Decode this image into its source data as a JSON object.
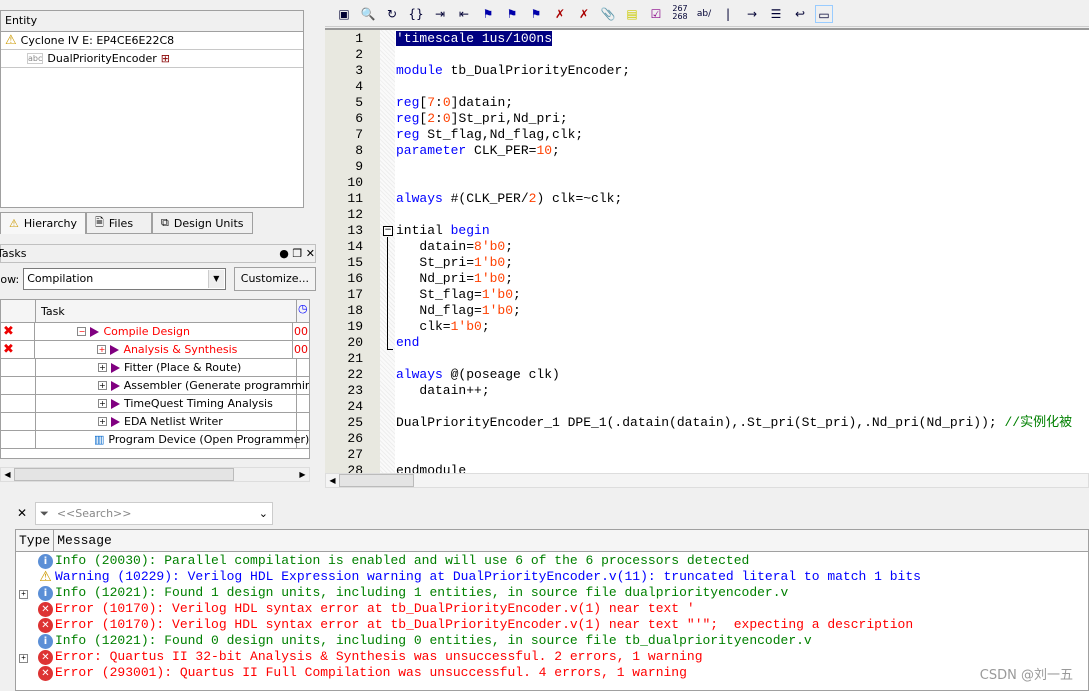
{
  "hierarchy": {
    "header": "Entity",
    "device": "Cyclone IV E: EP4CE6E22C8",
    "entity": "DualPriorityEncoder"
  },
  "tabs": [
    "Hierarchy",
    "Files",
    "Design Units"
  ],
  "tasks": {
    "title": "Tasks",
    "flow_label": "Flow:",
    "flow_value": "Compilation",
    "customize": "Customize...",
    "col_task": "Task",
    "rows": [
      {
        "label": "Compile Design",
        "status": "error",
        "time": "00",
        "color": "#ff0000",
        "indent": 0,
        "expander": "minus"
      },
      {
        "label": "Analysis & Synthesis",
        "status": "error",
        "time": "00",
        "color": "#ff0000",
        "indent": 1,
        "expander": "plus"
      },
      {
        "label": "Fitter (Place & Route)",
        "status": "",
        "time": "",
        "color": "#000000",
        "indent": 1,
        "expander": "plus"
      },
      {
        "label": "Assembler (Generate programming files)",
        "status": "",
        "time": "",
        "color": "#000000",
        "indent": 1,
        "expander": "plus"
      },
      {
        "label": "TimeQuest Timing Analysis",
        "status": "",
        "time": "",
        "color": "#000000",
        "indent": 1,
        "expander": "plus"
      },
      {
        "label": "EDA Netlist Writer",
        "status": "",
        "time": "",
        "color": "#000000",
        "indent": 1,
        "expander": "plus"
      },
      {
        "label": "Program Device (Open Programmer)",
        "status": "",
        "time": "",
        "color": "#000000",
        "indent": 0,
        "expander": "none"
      }
    ]
  },
  "toolbar": {
    "line_numbers_label": "267\n268",
    "abc_label": "ab/"
  },
  "code": [
    [
      [
        "'timescale 1us/100ns",
        "sel1"
      ]
    ],
    [],
    [
      [
        "module",
        "k"
      ],
      [
        " tb_DualPriorityEncoder;",
        ""
      ]
    ],
    [],
    [
      [
        "reg",
        "k"
      ],
      [
        "[",
        ""
      ],
      [
        "7",
        "n"
      ],
      [
        ":",
        ""
      ],
      [
        "0",
        "n"
      ],
      [
        "]datain;",
        ""
      ]
    ],
    [
      [
        "reg",
        "k"
      ],
      [
        "[",
        ""
      ],
      [
        "2",
        "n"
      ],
      [
        ":",
        ""
      ],
      [
        "0",
        "n"
      ],
      [
        "]St_pri,Nd_pri;",
        ""
      ]
    ],
    [
      [
        "reg",
        "k"
      ],
      [
        " St_flag,Nd_flag,clk;",
        ""
      ]
    ],
    [
      [
        "parameter",
        "k"
      ],
      [
        " CLK_PER=",
        ""
      ],
      [
        "10",
        "n"
      ],
      [
        ";",
        ""
      ]
    ],
    [],
    [],
    [
      [
        "always",
        "k"
      ],
      [
        " #(CLK_PER/",
        ""
      ],
      [
        "2",
        "n"
      ],
      [
        ") clk=~clk;",
        ""
      ]
    ],
    [],
    [
      [
        "intial ",
        ""
      ],
      [
        "begin",
        "k"
      ]
    ],
    [
      [
        "   datain=",
        ""
      ],
      [
        "8'b0",
        "n"
      ],
      [
        ";",
        ""
      ]
    ],
    [
      [
        "   St_pri=",
        ""
      ],
      [
        "1'b0",
        "n"
      ],
      [
        ";",
        ""
      ]
    ],
    [
      [
        "   Nd_pri=",
        ""
      ],
      [
        "1'b0",
        "n"
      ],
      [
        ";",
        ""
      ]
    ],
    [
      [
        "   St_flag=",
        ""
      ],
      [
        "1'b0",
        "n"
      ],
      [
        ";",
        ""
      ]
    ],
    [
      [
        "   Nd_flag=",
        ""
      ],
      [
        "1'b0",
        "n"
      ],
      [
        ";",
        ""
      ]
    ],
    [
      [
        "   clk=",
        ""
      ],
      [
        "1'b0",
        "n"
      ],
      [
        ";",
        ""
      ]
    ],
    [
      [
        "end",
        "k"
      ]
    ],
    [],
    [
      [
        "always",
        "k"
      ],
      [
        " @(poseage clk)",
        ""
      ]
    ],
    [
      [
        "   datain++;",
        ""
      ]
    ],
    [],
    [
      [
        "DualPriorityEncoder_1 DPE_1(.datain(datain),.St_pri(St_pri),.Nd_pri(Nd_pri)); ",
        ""
      ],
      [
        "//实例化被",
        "c"
      ]
    ],
    [],
    [],
    [
      [
        "endmodule",
        ""
      ]
    ]
  ],
  "messages": {
    "search_placeholder": "<<Search>>",
    "col_type": "Type",
    "col_message": "Message",
    "rows": [
      {
        "type": "info",
        "text": "Info (20030): Parallel compilation is enabled and will use 6 of the 6 processors detected",
        "color": "#008000",
        "expand": false
      },
      {
        "type": "warning",
        "text": "Warning (10229): Verilog HDL Expression warning at DualPriorityEncoder.v(11): truncated literal to match 1 bits",
        "color": "#0000ff",
        "expand": false
      },
      {
        "type": "info",
        "text": "Info (12021): Found 1 design units, including 1 entities, in source file dualpriorityencoder.v",
        "color": "#008000",
        "expand": true
      },
      {
        "type": "error",
        "text": "Error (10170): Verilog HDL syntax error at tb_DualPriorityEncoder.v(1) near text '",
        "color": "#ff0000",
        "expand": false
      },
      {
        "type": "error",
        "text": "Error (10170): Verilog HDL syntax error at tb_DualPriorityEncoder.v(1) near text \"'\";  expecting a description",
        "color": "#ff0000",
        "expand": false
      },
      {
        "type": "info",
        "text": "Info (12021): Found 0 design units, including 0 entities, in source file tb_dualpriorityencoder.v",
        "color": "#008000",
        "expand": false
      },
      {
        "type": "error",
        "text": "Error: Quartus II 32-bit Analysis & Synthesis was unsuccessful. 2 errors, 1 warning",
        "color": "#ff0000",
        "expand": true
      },
      {
        "type": "error",
        "text": "Error (293001): Quartus II Full Compilation was unsuccessful. 4 errors, 1 warning",
        "color": "#ff0000",
        "expand": false
      }
    ]
  },
  "watermark": "CSDN @刘一五"
}
